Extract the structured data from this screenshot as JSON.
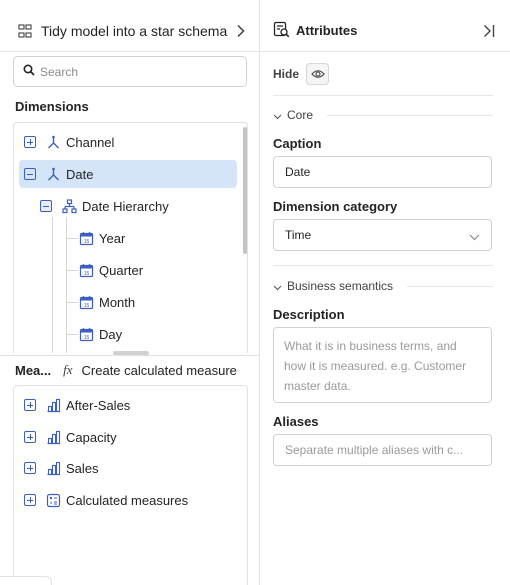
{
  "left_panel": {
    "header_title": "Tidy model into a star schema",
    "search_placeholder": "Search",
    "dimensions_label": "Dimensions",
    "dimension_tree": [
      {
        "label": "Channel",
        "icon": "dimension-icon",
        "expander": "plus"
      },
      {
        "label": "Date",
        "icon": "dimension-icon",
        "expander": "minus",
        "selected": true
      },
      {
        "label": "Date Hierarchy",
        "icon": "hierarchy-icon",
        "expander": "minus"
      },
      {
        "label": "Year",
        "icon": "calendar-icon"
      },
      {
        "label": "Quarter",
        "icon": "calendar-icon"
      },
      {
        "label": "Month",
        "icon": "calendar-icon"
      },
      {
        "label": "Day",
        "icon": "calendar-icon"
      }
    ],
    "measures_label": "Mea...",
    "fx_label": "fx",
    "create_measure_label": "Create calculated measure",
    "measure_groups": [
      {
        "label": "After-Sales",
        "icon": "measure-group-icon"
      },
      {
        "label": "Capacity",
        "icon": "measure-group-icon"
      },
      {
        "label": "Sales",
        "icon": "measure-group-icon"
      },
      {
        "label": "Calculated measures",
        "icon": "calculator-icon"
      }
    ]
  },
  "right_panel": {
    "title": "Attributes",
    "hide_label": "Hide",
    "core_group_label": "Core",
    "caption_label": "Caption",
    "caption_value": "Date",
    "dimension_category_label": "Dimension category",
    "dimension_category_value": "Time",
    "business_group_label": "Business semantics",
    "description_label": "Description",
    "description_placeholder": "What it is in business terms, and how it is measured. e.g. Customer master data.",
    "aliases_label": "Aliases",
    "aliases_placeholder": "Separate multiple aliases with c..."
  },
  "colors": {
    "accent": "#3b5fc0",
    "selection": "#d4e4f9",
    "border": "#d1d1d1"
  }
}
